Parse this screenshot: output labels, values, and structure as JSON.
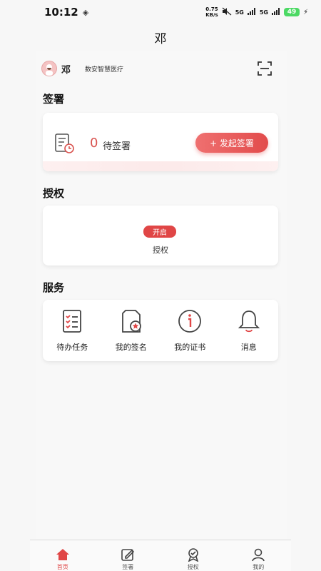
{
  "status_bar": {
    "time": "10:12",
    "net_speed_value": "0.75",
    "net_speed_unit": "KB/s",
    "signal1": "5G",
    "signal2": "5G",
    "battery": "49"
  },
  "page_title": "邓",
  "user": {
    "name": "邓",
    "org": "数安智慧医疗"
  },
  "sign_section": {
    "title": "签署",
    "pending_count": "0",
    "pending_label": "待签署",
    "start_button": "+ 发起签署"
  },
  "auth_section": {
    "title": "授权",
    "badge": "开启",
    "label": "授权"
  },
  "services_section": {
    "title": "服务",
    "items": [
      {
        "label": "待办任务",
        "icon": "todo-list-icon"
      },
      {
        "label": "我的签名",
        "icon": "signature-icon"
      },
      {
        "label": "我的证书",
        "icon": "info-icon"
      },
      {
        "label": "消息",
        "icon": "bell-icon"
      }
    ]
  },
  "bottom_nav": {
    "items": [
      {
        "label": "首页",
        "icon": "home-icon"
      },
      {
        "label": "签署",
        "icon": "edit-icon"
      },
      {
        "label": "授权",
        "icon": "badge-check-icon"
      },
      {
        "label": "我的",
        "icon": "user-icon"
      }
    ],
    "active_color": "#e04646"
  },
  "colors": {
    "accent": "#e04646",
    "pending": "#d9534f"
  }
}
